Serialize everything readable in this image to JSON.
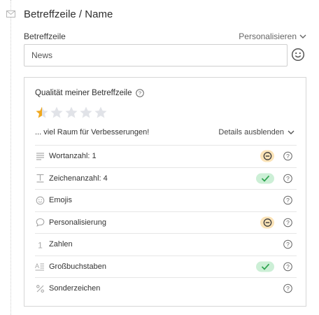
{
  "section": {
    "title": "Betreffzeile / Name"
  },
  "subject": {
    "label": "Betreffzeile",
    "personalize_label": "Personalisieren",
    "value": "News"
  },
  "quality": {
    "title": "Qualität meiner Betreffzeile",
    "rating": 0.5,
    "rating_max": 5,
    "verdict": "... viel Raum für Verbesserungen!",
    "details_toggle": "Details ausblenden",
    "criteria": [
      {
        "icon": "lines-icon",
        "label": "Wortanzahl: 1",
        "status": "warning"
      },
      {
        "icon": "text-height-icon",
        "label": "Zeichenanzahl: 4",
        "status": "ok"
      },
      {
        "icon": "smiley-icon",
        "label": "Emojis",
        "status": "none"
      },
      {
        "icon": "speech-bubble-icon",
        "label": "Personalisierung",
        "status": "warning"
      },
      {
        "icon": "number-one-icon",
        "label": "Zahlen",
        "status": "none"
      },
      {
        "icon": "uppercase-icon",
        "label": "Großbuchstaben",
        "status": "ok"
      },
      {
        "icon": "percent-icon",
        "label": "Sonderzeichen",
        "status": "none"
      }
    ]
  },
  "colors": {
    "star_filled": "#f0a81f",
    "star_empty": "#e1e3e8",
    "warning_bg": "#fbe3b7",
    "ok_bg": "#ccefd6",
    "ok_check": "#2ea44f"
  }
}
